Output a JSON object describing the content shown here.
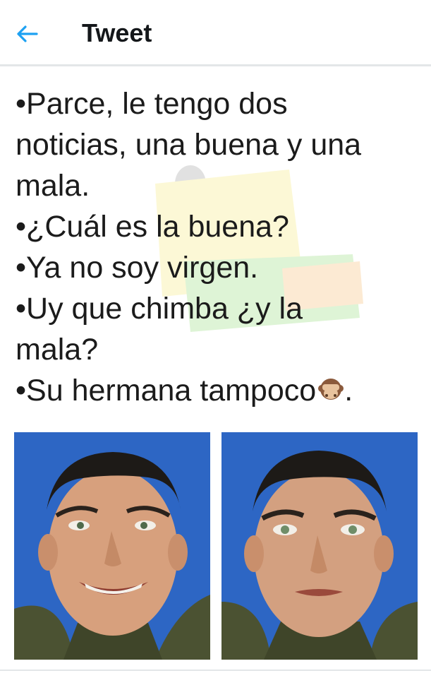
{
  "header": {
    "back_icon": "arrow-left-icon",
    "title": "Tweet",
    "accent_color": "#1da1f2"
  },
  "tweet": {
    "lines": [
      "•Parce, le tengo dos",
      "noticias, una buena y una",
      "mala.",
      "•¿Cuál es la buena?",
      "•Ya no soy virgen.",
      "•Uy que chimba ¿y la",
      "mala?",
      "•Su hermana tampoco"
    ],
    "last_line_suffix": ".",
    "emoji_icon": "see-no-evil-monkey-icon"
  },
  "media": {
    "images": [
      {
        "name": "smiling-man-photo",
        "expression": "smiling"
      },
      {
        "name": "serious-man-photo",
        "expression": "serious"
      }
    ]
  }
}
